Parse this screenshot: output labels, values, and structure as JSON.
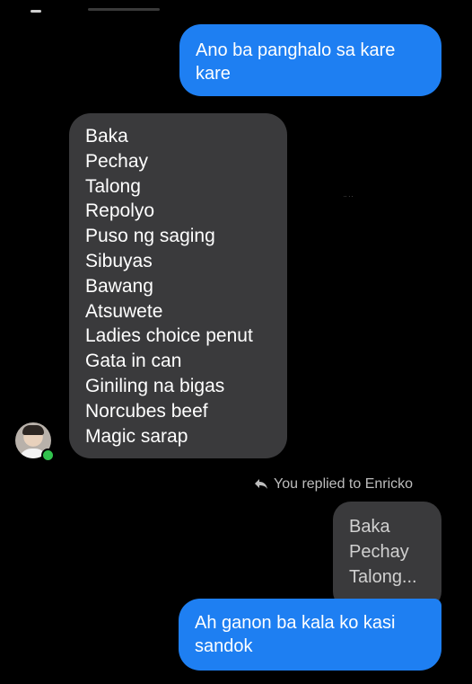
{
  "messages": {
    "first_outgoing": "Ano ba panghalo sa kare kare",
    "incoming_list": [
      "Baka",
      "Pechay",
      "Talong",
      "Repolyo",
      "Puso ng saging",
      "Sibuyas",
      "Bawang",
      "Atsuwete",
      "Ladies choice penut",
      "Gata in can",
      "Giniling na bigas",
      "Norcubes beef",
      "Magic sarap"
    ],
    "reply_indicator": "You replied to Enricko",
    "quoted_lines": [
      "Baka",
      "Pechay",
      "Talong..."
    ],
    "last_outgoing": "Ah ganon ba kala ko kasi sandok"
  },
  "colors": {
    "background": "#000000",
    "outgoing_bubble": "#1e7ff2",
    "incoming_bubble": "#3a3a3c",
    "online_dot": "#31c24d"
  },
  "icons": {
    "reply": "reply-arrow-icon",
    "avatar": "contact-avatar"
  }
}
